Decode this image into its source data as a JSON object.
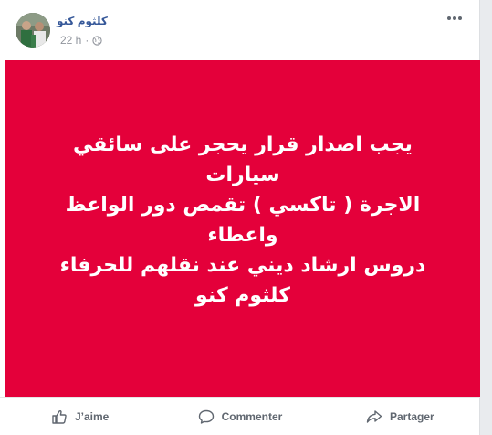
{
  "post": {
    "author": "كلثوم كنو",
    "time": "22 h",
    "separator": "·",
    "audience_icon": "globe-icon",
    "more_icon": "more-options-icon",
    "background_color": "#e4003a",
    "text": "يجب اصدار قرار يحجر على سائقي سيارات\nالاجرة ( تاكسي ) تقمص دور الواعظ واعطاء\nدروس ارشاد ديني عند نقلهم للحرفاء\nكلثوم كنو"
  },
  "actions": {
    "like": {
      "label": "J’aime",
      "icon": "thumbs-up-icon"
    },
    "comment": {
      "label": "Commenter",
      "icon": "comment-icon"
    },
    "share": {
      "label": "Partager",
      "icon": "share-icon"
    }
  }
}
